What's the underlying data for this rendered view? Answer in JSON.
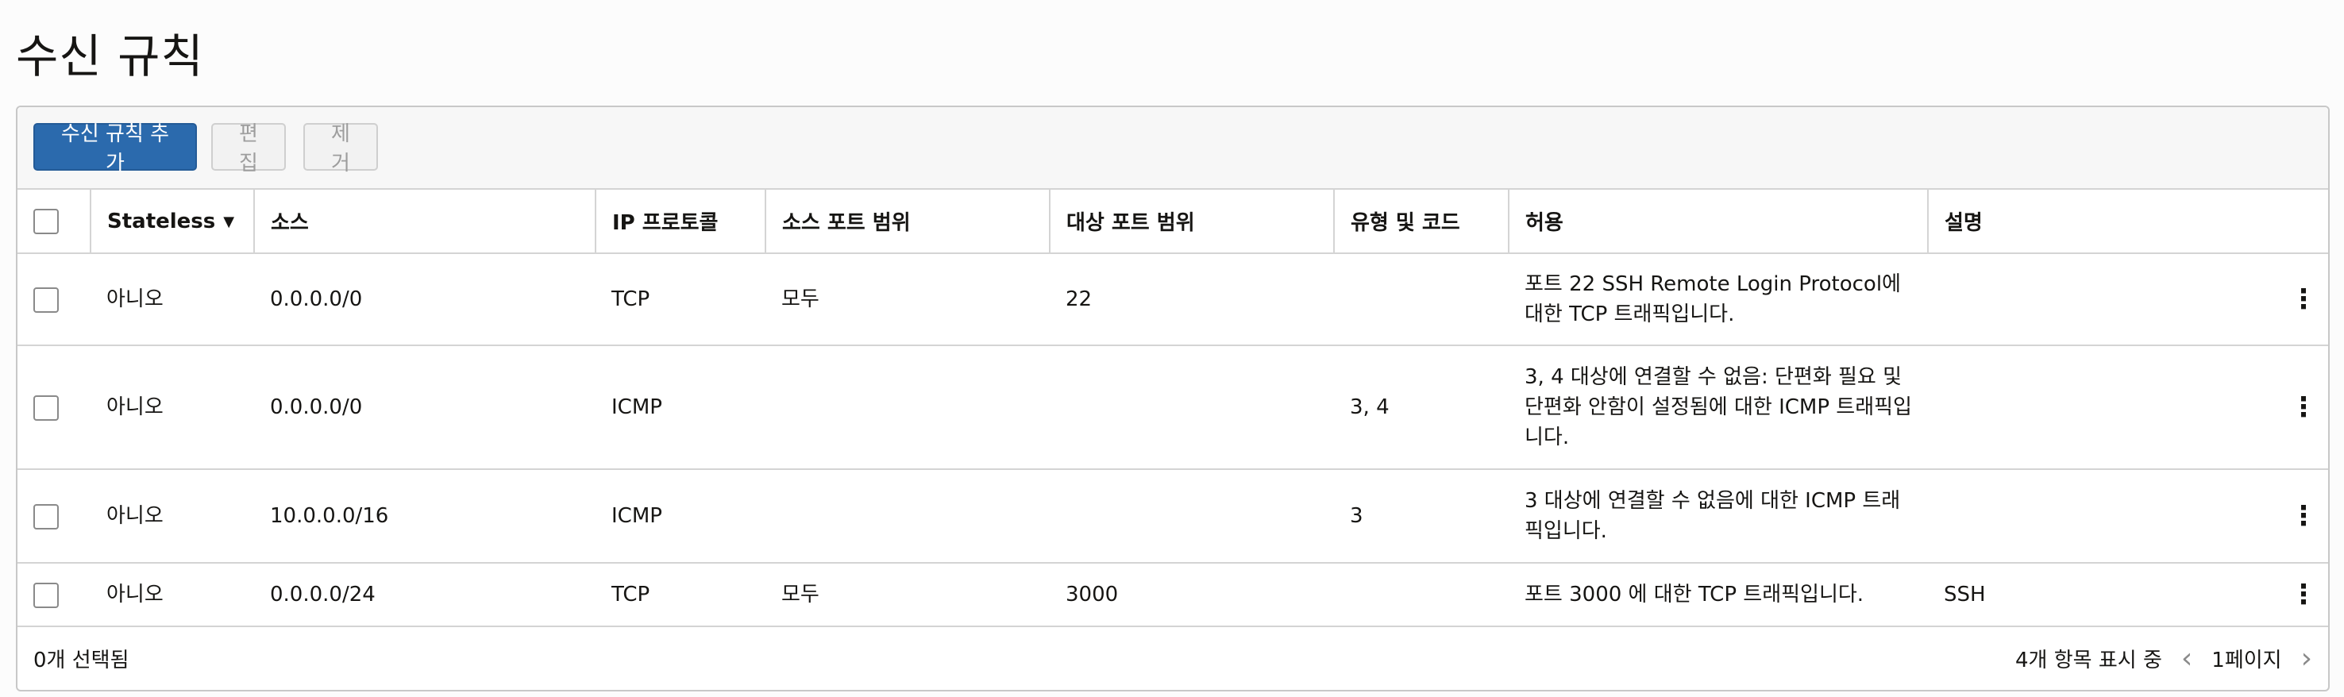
{
  "page": {
    "title": "수신 규칙"
  },
  "toolbar": {
    "add_label": "수신 규칙 추가",
    "edit_label": "편집",
    "remove_label": "제거"
  },
  "columns": [
    "Stateless",
    "소스",
    "IP 프로토콜",
    "소스 포트 범위",
    "대상 포트 범위",
    "유형 및 코드",
    "허용",
    "설명"
  ],
  "rows": [
    {
      "stateless": "아니오",
      "source": "0.0.0.0/0",
      "protocol": "TCP",
      "src_port": "모두",
      "dst_port": "22",
      "type_code": "",
      "allow": "포트 22 SSH Remote Login Protocol에 대한 TCP 트래픽입니다.",
      "desc": ""
    },
    {
      "stateless": "아니오",
      "source": "0.0.0.0/0",
      "protocol": "ICMP",
      "src_port": "",
      "dst_port": "",
      "type_code": "3, 4",
      "allow": "3, 4 대상에 연결할 수 없음: 단편화 필요 및 단편화 안함이 설정됨에 대한 ICMP 트래픽입니다.",
      "desc": ""
    },
    {
      "stateless": "아니오",
      "source": "10.0.0.0/16",
      "protocol": "ICMP",
      "src_port": "",
      "dst_port": "",
      "type_code": "3",
      "allow": "3 대상에 연결할 수 없음에 대한 ICMP 트래픽입니다.",
      "desc": ""
    },
    {
      "stateless": "아니오",
      "source": "0.0.0.0/24",
      "protocol": "TCP",
      "src_port": "모두",
      "dst_port": "3000",
      "type_code": "",
      "allow": "포트 3000 에 대한 TCP 트래픽입니다.",
      "desc": "SSH"
    }
  ],
  "footer": {
    "selected": "0개 선택됨",
    "count": "4개 항목 표시 중",
    "page": "1페이지"
  },
  "icons": {
    "sort": "sort-desc-icon",
    "kebab": "kebab-icon",
    "prev": "chevron-left-icon",
    "next": "chevron-right-icon"
  },
  "colors": {
    "primary": "#2b6aad",
    "border": "#d4d4d4"
  }
}
